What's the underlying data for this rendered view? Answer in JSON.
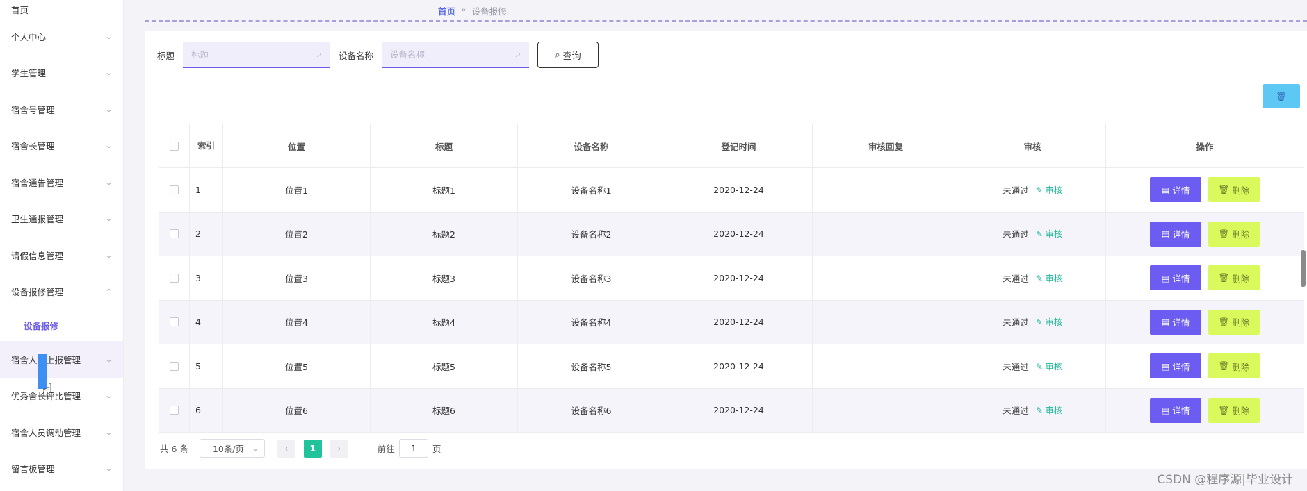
{
  "sidebar": {
    "items": [
      {
        "label": "首页",
        "chevron": false
      },
      {
        "label": "个人中心",
        "chevron": true
      },
      {
        "label": "学生管理",
        "chevron": true
      },
      {
        "label": "宿舍号管理",
        "chevron": true
      },
      {
        "label": "宿舍长管理",
        "chevron": true
      },
      {
        "label": "宿舍通告管理",
        "chevron": true
      },
      {
        "label": "卫生通报管理",
        "chevron": true
      },
      {
        "label": "请假信息管理",
        "chevron": true
      },
      {
        "label": "设备报修管理",
        "chevron": true,
        "expanded": true
      },
      {
        "label": "设备报修",
        "sub": true
      },
      {
        "label": "宿舍人员上报管理",
        "chevron": true
      },
      {
        "label": "优秀舍长评比管理",
        "chevron": true
      },
      {
        "label": "宿舍人员调动管理",
        "chevron": true
      },
      {
        "label": "留言板管理",
        "chevron": true
      }
    ]
  },
  "breadcrumb": {
    "home": "首页",
    "separator": "»",
    "current": "设备报修"
  },
  "search": {
    "title_label": "标题",
    "title_placeholder": "标题",
    "device_label": "设备名称",
    "device_placeholder": "设备名称",
    "query_label": "查询"
  },
  "table": {
    "headers": {
      "index": "索引",
      "position": "位置",
      "title": "标题",
      "device": "设备名称",
      "date": "登记时间",
      "reply": "审核回复",
      "audit": "审核",
      "ops": "操作"
    },
    "rows": [
      {
        "index": "1",
        "position": "位置1",
        "title": "标题1",
        "device": "设备名称1",
        "date": "2020-12-24",
        "reply": "",
        "status": "未通过",
        "audit_link": "审核",
        "detail": "详情",
        "delete": "删除"
      },
      {
        "index": "2",
        "position": "位置2",
        "title": "标题2",
        "device": "设备名称2",
        "date": "2020-12-24",
        "reply": "",
        "status": "未通过",
        "audit_link": "审核",
        "detail": "详情",
        "delete": "删除"
      },
      {
        "index": "3",
        "position": "位置3",
        "title": "标题3",
        "device": "设备名称3",
        "date": "2020-12-24",
        "reply": "",
        "status": "未通过",
        "audit_link": "审核",
        "detail": "详情",
        "delete": "删除"
      },
      {
        "index": "4",
        "position": "位置4",
        "title": "标题4",
        "device": "设备名称4",
        "date": "2020-12-24",
        "reply": "",
        "status": "未通过",
        "audit_link": "审核",
        "detail": "详情",
        "delete": "删除"
      },
      {
        "index": "5",
        "position": "位置5",
        "title": "标题5",
        "device": "设备名称5",
        "date": "2020-12-24",
        "reply": "",
        "status": "未通过",
        "audit_link": "审核",
        "detail": "详情",
        "delete": "删除"
      },
      {
        "index": "6",
        "position": "位置6",
        "title": "标题6",
        "device": "设备名称6",
        "date": "2020-12-24",
        "reply": "",
        "status": "未通过",
        "audit_link": "审核",
        "detail": "详情",
        "delete": "删除"
      }
    ]
  },
  "pagination": {
    "total": "共 6 条",
    "page_size": "10条/页",
    "current_page": "1",
    "goto_prefix": "前往",
    "goto_value": "1",
    "goto_suffix": "页"
  },
  "watermark": "CSDN @程序源|毕业设计",
  "colors": {
    "accent": "#6c5ce7",
    "detail_btn": "#6c5cf2",
    "delete_btn": "#d9f95c",
    "active_page": "#20c39c",
    "audit_link": "#1fb89a"
  },
  "icons": {
    "search": "search-icon",
    "chevron": "chevron-down-icon",
    "trash": "trash-icon",
    "doc": "document-icon",
    "edit": "edit-icon"
  }
}
